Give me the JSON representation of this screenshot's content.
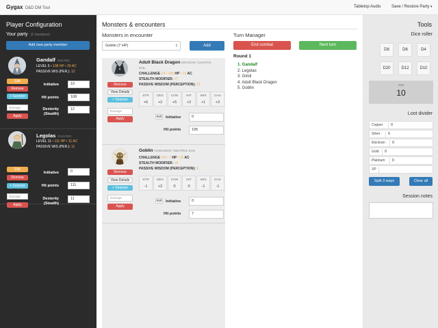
{
  "navbar": {
    "brand": "Gygax",
    "brand_sub": "D&D DM Tool",
    "tabletop_audio": "Tabletop Audio",
    "save_restore": "Save / Restore Party"
  },
  "sidebar": {
    "title": "Player Configuration",
    "party_title": "Your party",
    "party_count": "(2 members)",
    "add_member": "Add new party member",
    "players": [
      {
        "name": "Gandalf",
        "class": "Wizard",
        "level_line": "LEVEL",
        "level": "5",
        "hp_text": "108 HP",
        "ac_text": "20 AC",
        "passive_label": "PASSIVE WIS (PER.):",
        "passive": "12",
        "edit": "Edit",
        "remove": "Remove",
        "surprise": "+ Surprise",
        "damage_placeholder": "Damage",
        "apply": "Apply",
        "initiative_label": "Initiative",
        "initiative": "10",
        "hp_label": "Hit points",
        "hp": "108",
        "dex_label": "Dexterity (Stealth)",
        "dex": "12"
      },
      {
        "name": "Legolas",
        "class": "Fighter",
        "level_line": "LEVEL",
        "level": "11",
        "hp_text": "111 HP",
        "ac_text": "11 AC",
        "passive_label": "PASSIVE WIS (PER.):",
        "passive": "11",
        "edit": "Edit",
        "remove": "Remove",
        "surprise": "+ Surprise",
        "damage_placeholder": "Damage",
        "apply": "Apply",
        "initiative_label": "Initiative",
        "initiative": "0",
        "hp_label": "Hit points",
        "hp": "111",
        "dex_label": "Dexterity (Stealth)",
        "dex": "11"
      }
    ]
  },
  "main": {
    "title": "Monsters & encounters",
    "encounter_title": "Monsters in encounter",
    "select_value": "Goblin (7 HP)",
    "add": "Add",
    "monsters": [
      {
        "name": "Adult Black Dragon",
        "type1": "Dragon / Chaotic",
        "type2": "Evil",
        "challenge_label": "Challenge",
        "challenge": "14",
        "hp_txt": "195",
        "ac_txt": "19",
        "stealth_label": "Stealth modifier:",
        "stealth": "+7",
        "passive_label": "Passive wisdom (perception):",
        "passive": "21",
        "remove": "Remove",
        "details": "View Details",
        "surprise": "+ Surprise",
        "damage_placeholder": "Damage",
        "apply": "Apply",
        "stats": [
          {
            "n": "STR",
            "v": "+6"
          },
          {
            "n": "DEX",
            "v": "+2"
          },
          {
            "n": "CON",
            "v": "+5"
          },
          {
            "n": "INT",
            "v": "+2"
          },
          {
            "n": "WIS",
            "v": "+1"
          },
          {
            "n": "CHA",
            "v": "+3"
          }
        ],
        "roll": "Roll",
        "initiative_label": "Initiative",
        "initiative": "0",
        "hp_label": "Hit points",
        "hp": "195"
      },
      {
        "name": "Goblin",
        "type1": "Humanoid / Neutral Evil",
        "challenge_label": "Challenge",
        "challenge": "1/4",
        "hp_txt": "7",
        "ac_txt": "15",
        "stealth_label": "Stealth modifier:",
        "stealth": "+6",
        "passive_label": "Passive wisdom (perception):",
        "passive": "9",
        "remove": "Remove",
        "details": "View Details",
        "surprise": "+ Surprise",
        "damage_placeholder": "Damage",
        "apply": "Apply",
        "stats": [
          {
            "n": "STR",
            "v": "-1"
          },
          {
            "n": "DEX",
            "v": "+2"
          },
          {
            "n": "CON",
            "v": "0"
          },
          {
            "n": "INT",
            "v": "0"
          },
          {
            "n": "WIS",
            "v": "-1"
          },
          {
            "n": "CHA",
            "v": "-1"
          }
        ],
        "roll": "Roll",
        "initiative_label": "Initiative",
        "initiative": "0",
        "hp_label": "Hit points",
        "hp": "7"
      }
    ],
    "turn_title": "Turn Manager",
    "end_combat": "End combat",
    "next_turn": "Next turn",
    "round": "Round 1",
    "turn_order": [
      "Gandalf",
      "Legolas",
      "Gimli",
      "Adult Black Dragon",
      "Goblin"
    ]
  },
  "tools": {
    "title": "Tools",
    "dice_title": "Dice roller",
    "dice": [
      "D8",
      "D6",
      "D4",
      "D20",
      "D12",
      "D10"
    ],
    "result_label": "D20",
    "result": "10",
    "loot_title": "Loot divider",
    "loot": [
      {
        "label": "Copper",
        "value": "0"
      },
      {
        "label": "Silver",
        "value": "0"
      },
      {
        "label": "Electrum",
        "value": "0"
      },
      {
        "label": "Gold",
        "value": "0"
      },
      {
        "label": "Platinum",
        "value": "0"
      },
      {
        "label": "XP",
        "value": ""
      }
    ],
    "split": "Split 3 ways",
    "clear": "Clear all",
    "notes_title": "Session notes"
  },
  "colors": {
    "primary": "#337ab7",
    "danger": "#d9534f",
    "success": "#5cb85c",
    "warning": "#f0ad4e",
    "info": "#5bc0de",
    "sidebar_bg": "#2b2b2b"
  }
}
